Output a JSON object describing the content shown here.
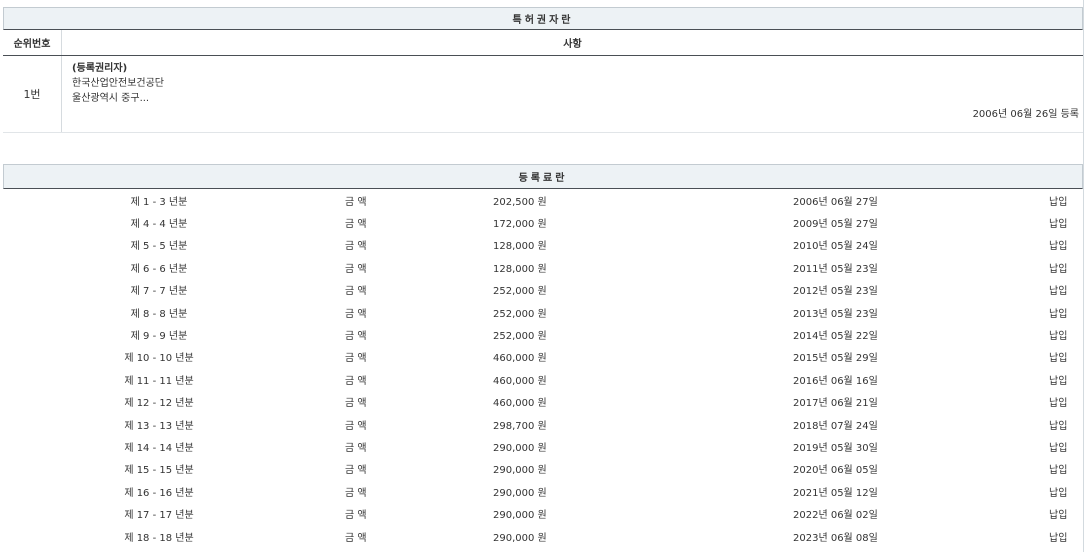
{
  "holder_section": {
    "title": "특허권자란",
    "col_rank": "순위번호",
    "col_matter": "사항",
    "entry": {
      "rank": "1번",
      "kind": "(등록권리자)",
      "name": "한국산업안전보건공단",
      "address": "울산광역시 중구...",
      "date": "2006년 06월 26일 등록"
    }
  },
  "fee_section": {
    "title": "등록료란",
    "rows": [
      {
        "period": "제 1 - 3 년분",
        "label": "금 액",
        "amount": "202,500 원",
        "paid_date": "2006년 06월 27일",
        "status": "납입"
      },
      {
        "period": "제 4 - 4 년분",
        "label": "금 액",
        "amount": "172,000 원",
        "paid_date": "2009년 05월 27일",
        "status": "납입"
      },
      {
        "period": "제 5 - 5 년분",
        "label": "금 액",
        "amount": "128,000 원",
        "paid_date": "2010년 05월 24일",
        "status": "납입"
      },
      {
        "period": "제 6 - 6 년분",
        "label": "금 액",
        "amount": "128,000 원",
        "paid_date": "2011년 05월 23일",
        "status": "납입"
      },
      {
        "period": "제 7 - 7 년분",
        "label": "금 액",
        "amount": "252,000 원",
        "paid_date": "2012년 05월 23일",
        "status": "납입"
      },
      {
        "period": "제 8 - 8 년분",
        "label": "금 액",
        "amount": "252,000 원",
        "paid_date": "2013년 05월 23일",
        "status": "납입"
      },
      {
        "period": "제 9 - 9 년분",
        "label": "금 액",
        "amount": "252,000 원",
        "paid_date": "2014년 05월 22일",
        "status": "납입"
      },
      {
        "period": "제 10 - 10 년분",
        "label": "금 액",
        "amount": "460,000 원",
        "paid_date": "2015년 05월 29일",
        "status": "납입"
      },
      {
        "period": "제 11 - 11 년분",
        "label": "금 액",
        "amount": "460,000 원",
        "paid_date": "2016년 06월 16일",
        "status": "납입"
      },
      {
        "period": "제 12 - 12 년분",
        "label": "금 액",
        "amount": "460,000 원",
        "paid_date": "2017년 06월 21일",
        "status": "납입"
      },
      {
        "period": "제 13 - 13 년분",
        "label": "금 액",
        "amount": "298,700 원",
        "paid_date": "2018년 07월 24일",
        "status": "납입"
      },
      {
        "period": "제 14 - 14 년분",
        "label": "금 액",
        "amount": "290,000 원",
        "paid_date": "2019년 05월 30일",
        "status": "납입"
      },
      {
        "period": "제 15 - 15 년분",
        "label": "금 액",
        "amount": "290,000 원",
        "paid_date": "2020년 06월 05일",
        "status": "납입"
      },
      {
        "period": "제 16 - 16 년분",
        "label": "금 액",
        "amount": "290,000 원",
        "paid_date": "2021년 05월 12일",
        "status": "납입"
      },
      {
        "period": "제 17 - 17 년분",
        "label": "금 액",
        "amount": "290,000 원",
        "paid_date": "2022년 06월 02일",
        "status": "납입"
      },
      {
        "period": "제 18 - 18 년분",
        "label": "금 액",
        "amount": "290,000 원",
        "paid_date": "2023년 06월 08일",
        "status": "납입"
      }
    ]
  }
}
